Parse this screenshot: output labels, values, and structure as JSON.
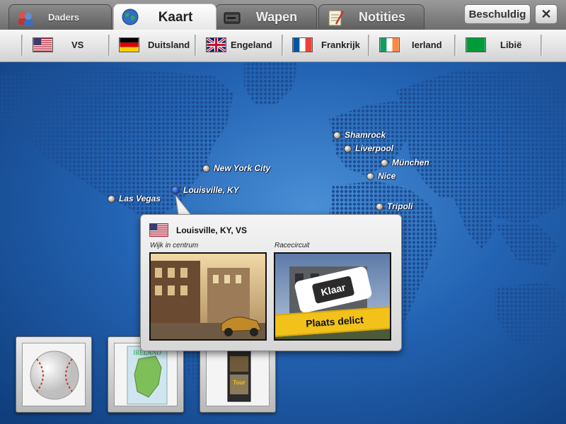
{
  "tabs": [
    {
      "id": "daders",
      "label": "Daders",
      "icon": "suspects-icon",
      "active": false
    },
    {
      "id": "kaart",
      "label": "Kaart",
      "icon": "globe-icon",
      "active": true
    },
    {
      "id": "wapen",
      "label": "Wapen",
      "icon": "weapon-case-icon",
      "active": false
    },
    {
      "id": "notities",
      "label": "Notities",
      "icon": "notepad-icon",
      "active": false
    }
  ],
  "toolbar": {
    "accuse_label": "Beschuldig",
    "close_symbol": "✕"
  },
  "countries": [
    {
      "label": "VS",
      "flag": "usa"
    },
    {
      "label": "Duitsland",
      "flag": "germany"
    },
    {
      "label": "Engeland",
      "flag": "uk"
    },
    {
      "label": "Frankrijk",
      "flag": "france"
    },
    {
      "label": "Ierland",
      "flag": "ireland"
    },
    {
      "label": "Libië",
      "flag": "libya"
    }
  ],
  "cities": [
    {
      "name": "Las Vegas",
      "selected": false
    },
    {
      "name": "Louisville, KY",
      "selected": true
    },
    {
      "name": "New York City",
      "selected": false
    },
    {
      "name": "Shamrock",
      "selected": false
    },
    {
      "name": "Liverpool",
      "selected": false
    },
    {
      "name": "München",
      "selected": false
    },
    {
      "name": "Nice",
      "selected": false
    },
    {
      "name": "Tripoli",
      "selected": false
    }
  ],
  "popup": {
    "title": "Louisville, KY, VS",
    "flag": "usa",
    "locations": [
      {
        "label": "Wijk in centrum",
        "status": ""
      },
      {
        "label": "Racecircuit",
        "status": "Klaar",
        "banner": "Plaats delict"
      }
    ]
  },
  "evidence": [
    {
      "icon": "baseball-icon",
      "text": ""
    },
    {
      "icon": "ireland-map-icon",
      "text": "IRELAND"
    },
    {
      "icon": "tour-brochure-icon",
      "text": "Tour"
    }
  ],
  "colors": {
    "ocean": "#2363b3",
    "land_dots": "#1c4f96",
    "banner_yellow": "#f2c21a"
  }
}
